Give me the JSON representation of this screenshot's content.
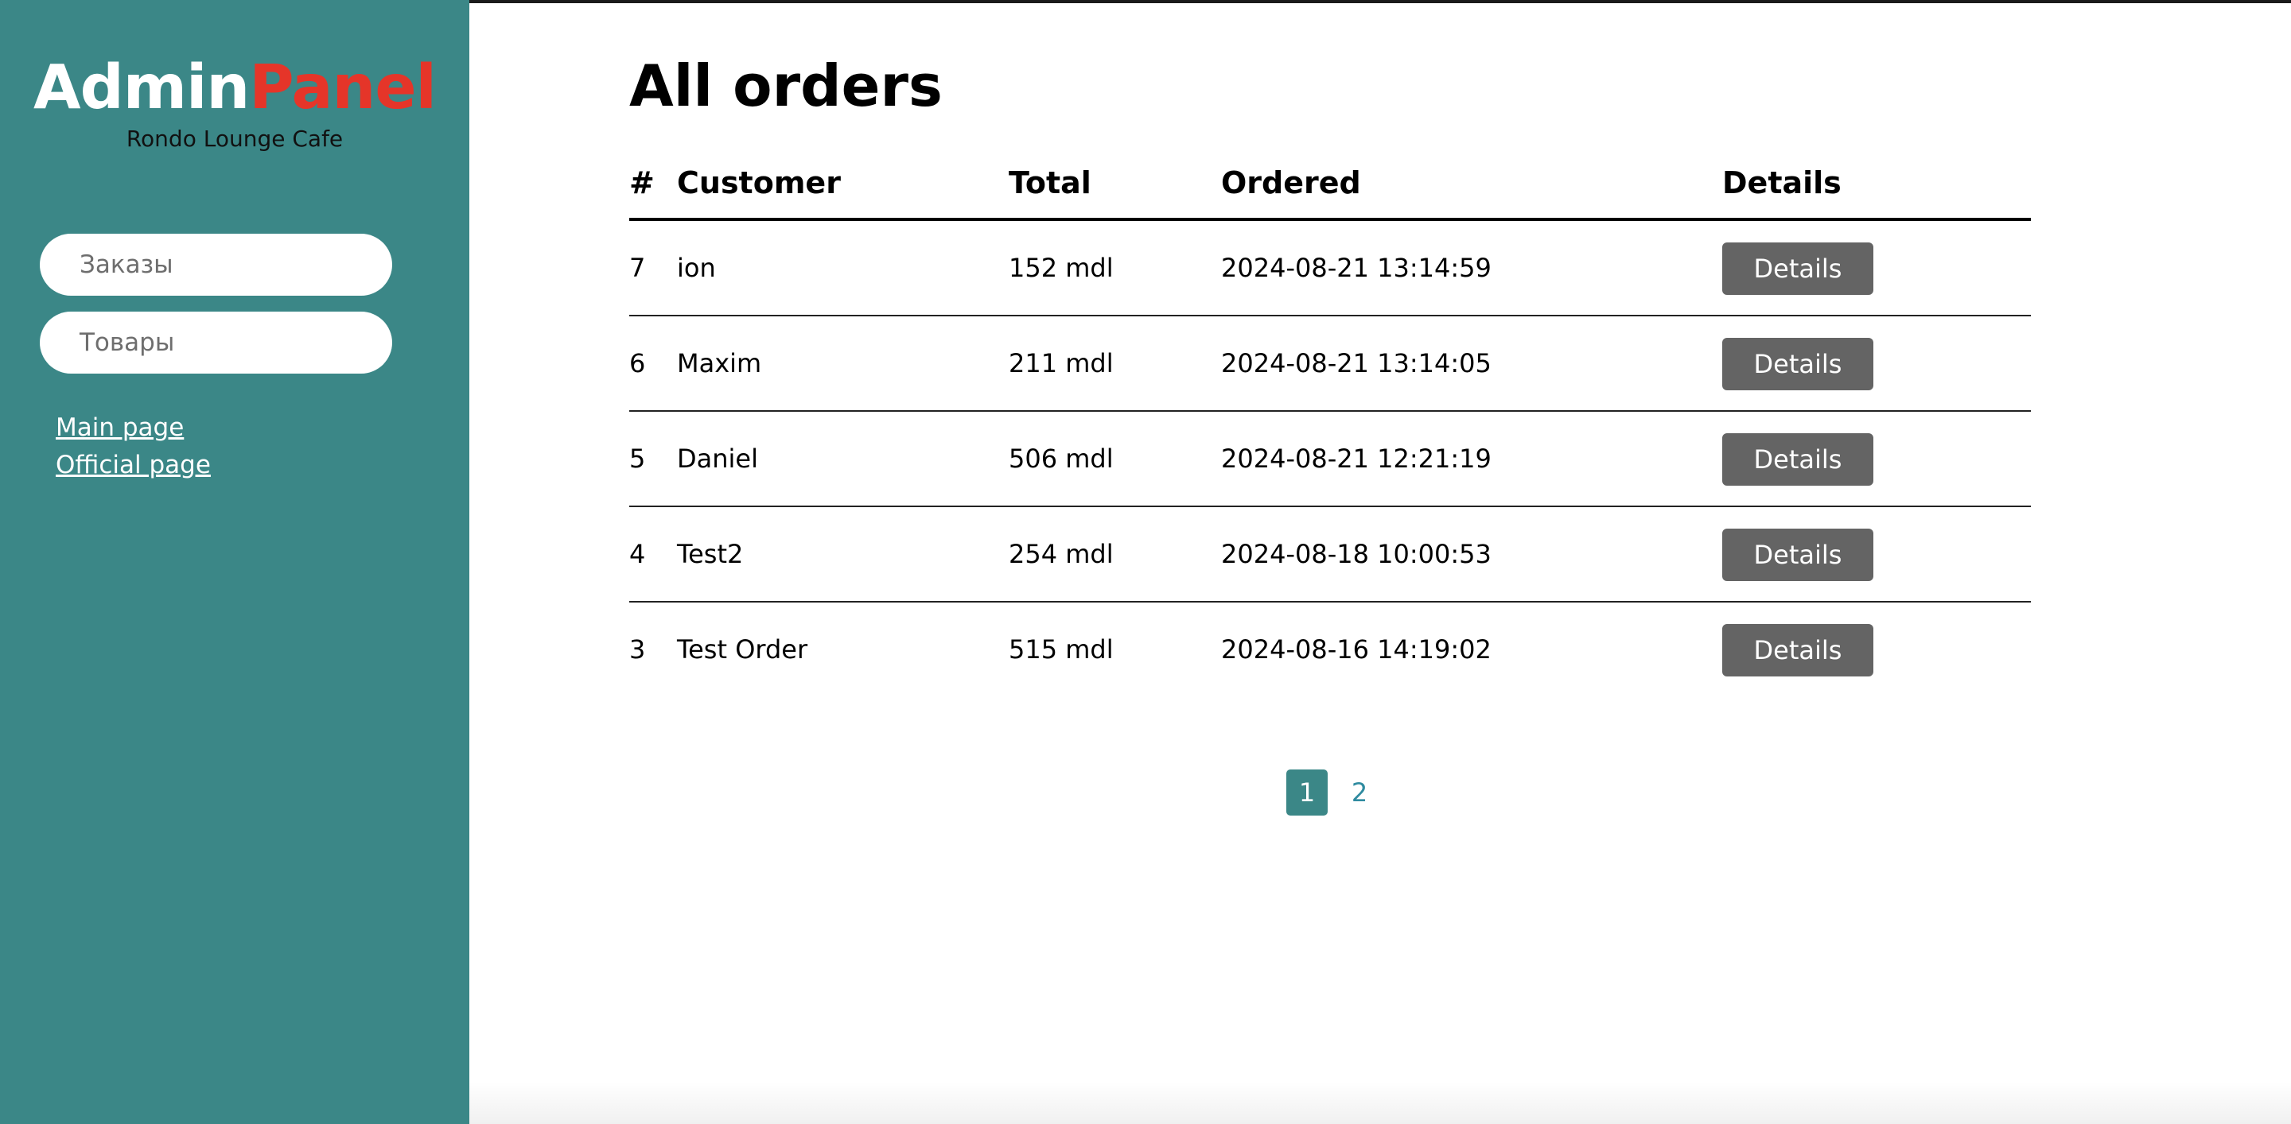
{
  "sidebar": {
    "brand_part1": "Admin",
    "brand_part2": "Panel",
    "subtitle": "Rondo Lounge Cafe",
    "nav_buttons": [
      {
        "label": "Заказы"
      },
      {
        "label": "Товары"
      }
    ],
    "links": [
      {
        "label": "Main page"
      },
      {
        "label": "Official page"
      }
    ]
  },
  "main": {
    "title": "All orders",
    "table": {
      "headers": {
        "num": "#",
        "customer": "Customer",
        "total": "Total",
        "ordered": "Ordered",
        "details": "Details"
      },
      "rows": [
        {
          "num": "7",
          "customer": "ion",
          "total": "152 mdl",
          "ordered": "2024-08-21 13:14:59",
          "button": "Details"
        },
        {
          "num": "6",
          "customer": "Maxim",
          "total": "211 mdl",
          "ordered": "2024-08-21 13:14:05",
          "button": "Details"
        },
        {
          "num": "5",
          "customer": "Daniel",
          "total": "506 mdl",
          "ordered": "2024-08-21 12:21:19",
          "button": "Details"
        },
        {
          "num": "4",
          "customer": "Test2",
          "total": "254 mdl",
          "ordered": "2024-08-18 10:00:53",
          "button": "Details"
        },
        {
          "num": "3",
          "customer": "Test Order",
          "total": "515 mdl",
          "ordered": "2024-08-16 14:19:02",
          "button": "Details"
        }
      ]
    },
    "pagination": {
      "current": "1",
      "next": "2"
    }
  },
  "colors": {
    "sidebar_bg": "#3b8787",
    "brand_accent": "#e53529",
    "button_bg": "#646464",
    "page_link": "#2f8ba0"
  }
}
